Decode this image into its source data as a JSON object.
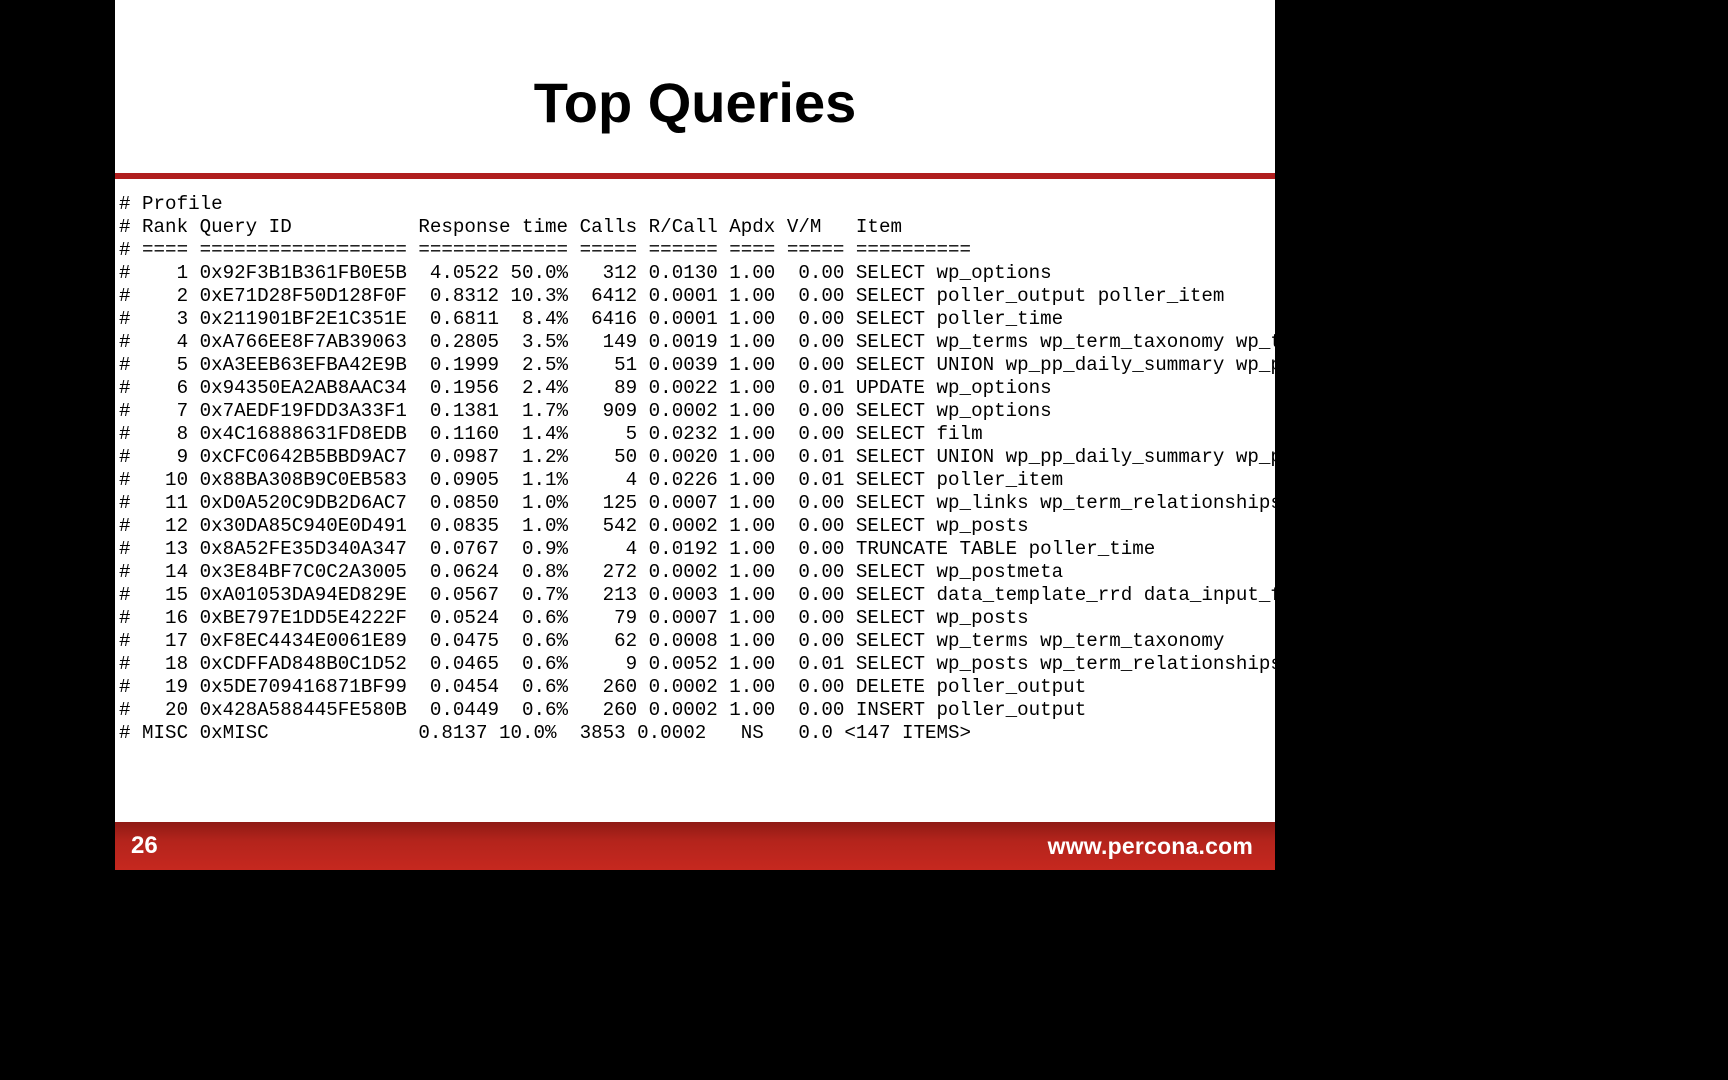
{
  "title": "Top Queries",
  "page_number": "26",
  "url": "www.percona.com",
  "profile_header1": "# Profile",
  "profile_header2": "# Rank Query ID           Response time Calls R/Call Apdx V/M   Item",
  "profile_rule": "# ==== ================== ============= ===== ====== ==== ===== ==========",
  "rows": [
    {
      "rank": "1",
      "qid": "0x92F3B1B361FB0E5B",
      "rt": "4.0522",
      "pct": "50.0%",
      "calls": "312",
      "rcall": "0.0130",
      "apdx": "1.00",
      "vm": "0.00",
      "item": "SELECT wp_options"
    },
    {
      "rank": "2",
      "qid": "0xE71D28F50D128F0F",
      "rt": "0.8312",
      "pct": "10.3%",
      "calls": "6412",
      "rcall": "0.0001",
      "apdx": "1.00",
      "vm": "0.00",
      "item": "SELECT poller_output poller_item"
    },
    {
      "rank": "3",
      "qid": "0x211901BF2E1C351E",
      "rt": "0.6811",
      "pct": "8.4%",
      "calls": "6416",
      "rcall": "0.0001",
      "apdx": "1.00",
      "vm": "0.00",
      "item": "SELECT poller_time"
    },
    {
      "rank": "4",
      "qid": "0xA766EE8F7AB39063",
      "rt": "0.2805",
      "pct": "3.5%",
      "calls": "149",
      "rcall": "0.0019",
      "apdx": "1.00",
      "vm": "0.00",
      "item": "SELECT wp_terms wp_term_taxonomy wp_term"
    },
    {
      "rank": "5",
      "qid": "0xA3EEB63EFBA42E9B",
      "rt": "0.1999",
      "pct": "2.5%",
      "calls": "51",
      "rcall": "0.0039",
      "apdx": "1.00",
      "vm": "0.00",
      "item": "SELECT UNION wp_pp_daily_summary wp_pp_h"
    },
    {
      "rank": "6",
      "qid": "0x94350EA2AB8AAC34",
      "rt": "0.1956",
      "pct": "2.4%",
      "calls": "89",
      "rcall": "0.0022",
      "apdx": "1.00",
      "vm": "0.01",
      "item": "UPDATE wp_options"
    },
    {
      "rank": "7",
      "qid": "0x7AEDF19FDD3A33F1",
      "rt": "0.1381",
      "pct": "1.7%",
      "calls": "909",
      "rcall": "0.0002",
      "apdx": "1.00",
      "vm": "0.00",
      "item": "SELECT wp_options"
    },
    {
      "rank": "8",
      "qid": "0x4C16888631FD8EDB",
      "rt": "0.1160",
      "pct": "1.4%",
      "calls": "5",
      "rcall": "0.0232",
      "apdx": "1.00",
      "vm": "0.00",
      "item": "SELECT film"
    },
    {
      "rank": "9",
      "qid": "0xCFC0642B5BBD9AC7",
      "rt": "0.0987",
      "pct": "1.2%",
      "calls": "50",
      "rcall": "0.0020",
      "apdx": "1.00",
      "vm": "0.01",
      "item": "SELECT UNION wp_pp_daily_summary wp_pp_h"
    },
    {
      "rank": "10",
      "qid": "0x88BA308B9C0EB583",
      "rt": "0.0905",
      "pct": "1.1%",
      "calls": "4",
      "rcall": "0.0226",
      "apdx": "1.00",
      "vm": "0.01",
      "item": "SELECT poller_item"
    },
    {
      "rank": "11",
      "qid": "0xD0A520C9DB2D6AC7",
      "rt": "0.0850",
      "pct": "1.0%",
      "calls": "125",
      "rcall": "0.0007",
      "apdx": "1.00",
      "vm": "0.00",
      "item": "SELECT wp_links wp_term_relationships wp"
    },
    {
      "rank": "12",
      "qid": "0x30DA85C940E0D491",
      "rt": "0.0835",
      "pct": "1.0%",
      "calls": "542",
      "rcall": "0.0002",
      "apdx": "1.00",
      "vm": "0.00",
      "item": "SELECT wp_posts"
    },
    {
      "rank": "13",
      "qid": "0x8A52FE35D340A347",
      "rt": "0.0767",
      "pct": "0.9%",
      "calls": "4",
      "rcall": "0.0192",
      "apdx": "1.00",
      "vm": "0.00",
      "item": "TRUNCATE TABLE poller_time"
    },
    {
      "rank": "14",
      "qid": "0x3E84BF7C0C2A3005",
      "rt": "0.0624",
      "pct": "0.8%",
      "calls": "272",
      "rcall": "0.0002",
      "apdx": "1.00",
      "vm": "0.00",
      "item": "SELECT wp_postmeta"
    },
    {
      "rank": "15",
      "qid": "0xA01053DA94ED829E",
      "rt": "0.0567",
      "pct": "0.7%",
      "calls": "213",
      "rcall": "0.0003",
      "apdx": "1.00",
      "vm": "0.00",
      "item": "SELECT data_template_rrd data_input_fiel"
    },
    {
      "rank": "16",
      "qid": "0xBE797E1DD5E4222F",
      "rt": "0.0524",
      "pct": "0.6%",
      "calls": "79",
      "rcall": "0.0007",
      "apdx": "1.00",
      "vm": "0.00",
      "item": "SELECT wp_posts"
    },
    {
      "rank": "17",
      "qid": "0xF8EC4434E0061E89",
      "rt": "0.0475",
      "pct": "0.6%",
      "calls": "62",
      "rcall": "0.0008",
      "apdx": "1.00",
      "vm": "0.00",
      "item": "SELECT wp_terms wp_term_taxonomy"
    },
    {
      "rank": "18",
      "qid": "0xCDFFAD848B0C1D52",
      "rt": "0.0465",
      "pct": "0.6%",
      "calls": "9",
      "rcall": "0.0052",
      "apdx": "1.00",
      "vm": "0.01",
      "item": "SELECT wp_posts wp_term_relationships"
    },
    {
      "rank": "19",
      "qid": "0x5DE709416871BF99",
      "rt": "0.0454",
      "pct": "0.6%",
      "calls": "260",
      "rcall": "0.0002",
      "apdx": "1.00",
      "vm": "0.00",
      "item": "DELETE poller_output"
    },
    {
      "rank": "20",
      "qid": "0x428A588445FE580B",
      "rt": "0.0449",
      "pct": "0.6%",
      "calls": "260",
      "rcall": "0.0002",
      "apdx": "1.00",
      "vm": "0.00",
      "item": "INSERT poller_output"
    }
  ],
  "misc": {
    "label": "MISC",
    "qid": "0xMISC",
    "rt": "0.8137",
    "pct": "10.0%",
    "calls": "3853",
    "rcall": "0.0002",
    "apdx": "NS",
    "vm": "0.0",
    "item": "<147 ITEMS>"
  }
}
